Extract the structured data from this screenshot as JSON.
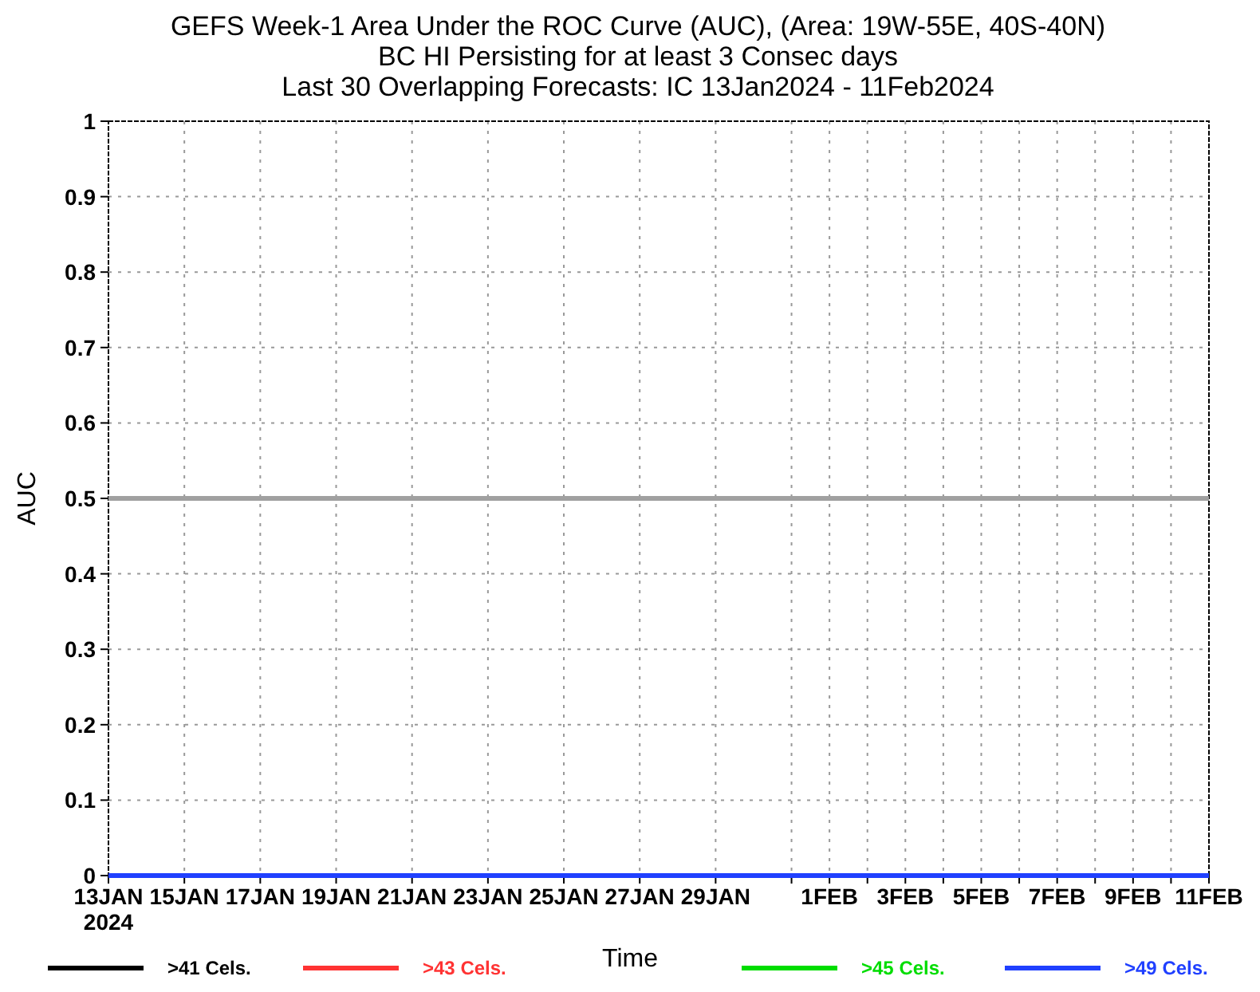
{
  "chart_data": {
    "type": "line",
    "title": [
      "GEFS Week-1 Area Under the ROC Curve (AUC), (Area: 19W-55E, 40S-40N)",
      "BC HI Persisting for at least 3 Consec days",
      "Last 30 Overlapping Forecasts: IC 13Jan2024 - 11Feb2024"
    ],
    "xlabel": "Time",
    "ylabel": "AUC",
    "categories": [
      "13JAN",
      null,
      "15JAN",
      null,
      "17JAN",
      null,
      "19JAN",
      null,
      "21JAN",
      null,
      "23JAN",
      null,
      "25JAN",
      null,
      "27JAN",
      null,
      "29JAN",
      null,
      null,
      "1FEB",
      null,
      "3FEB",
      null,
      "5FEB",
      null,
      "7FEB",
      null,
      "9FEB",
      null,
      "11FEB"
    ],
    "series": [
      {
        "name": ">41 Cels.",
        "color": "#000000",
        "values": [
          null,
          null,
          null,
          null,
          null,
          null,
          null,
          null,
          null,
          null,
          null,
          null,
          null,
          null,
          null,
          null,
          null,
          null,
          null,
          null,
          null,
          null,
          null,
          null,
          null,
          null,
          null,
          null,
          null,
          null
        ]
      },
      {
        "name": ">43 Cels.",
        "color": "#ff3333",
        "values": [
          null,
          null,
          null,
          null,
          null,
          null,
          null,
          null,
          null,
          null,
          null,
          null,
          null,
          null,
          null,
          null,
          null,
          null,
          null,
          null,
          null,
          null,
          null,
          null,
          null,
          null,
          null,
          null,
          null,
          null
        ]
      },
      {
        "name": ">45 Cels.",
        "color": "#00dd00",
        "values": [
          null,
          null,
          null,
          null,
          null,
          null,
          null,
          null,
          null,
          null,
          null,
          null,
          null,
          null,
          null,
          null,
          null,
          null,
          null,
          null,
          null,
          null,
          null,
          null,
          null,
          null,
          null,
          null,
          null,
          null
        ]
      },
      {
        "name": ">49 Cels.",
        "color": "#2040ff",
        "values": [
          0,
          0,
          0,
          0,
          0,
          0,
          0,
          0,
          0,
          0,
          0,
          0,
          0,
          0,
          0,
          0,
          0,
          0,
          0,
          0,
          0,
          0,
          0,
          0,
          0,
          0,
          0,
          0,
          0,
          0
        ]
      }
    ],
    "ylim": [
      0,
      1
    ],
    "yticks": [
      0,
      0.1,
      0.2,
      0.3,
      0.4,
      0.5,
      0.6,
      0.7,
      0.8,
      0.9,
      1
    ],
    "ref_lines": [
      {
        "axis": "y",
        "value": 0.5
      }
    ],
    "grid": true,
    "legend": true
  },
  "x_axis": {
    "year_label": "2024"
  }
}
